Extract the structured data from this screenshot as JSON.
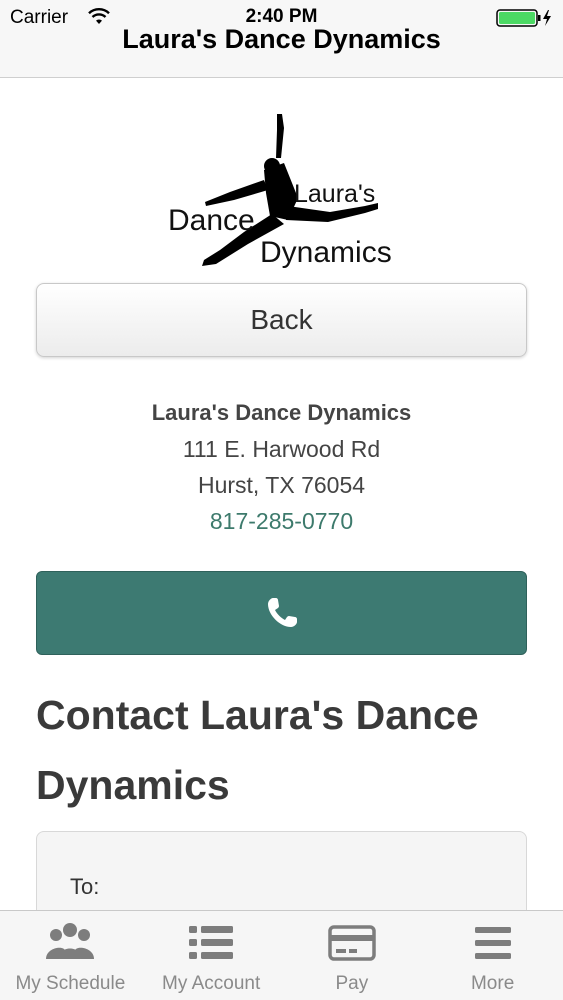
{
  "status_bar": {
    "carrier": "Carrier",
    "time": "2:40 PM",
    "battery_color": "#4cd964"
  },
  "nav": {
    "title": "Laura's Dance Dynamics"
  },
  "logo": {
    "line1": "Laura's",
    "line2": "Dance",
    "line3": "Dynamics"
  },
  "back_button": {
    "label": "Back"
  },
  "address": {
    "name": "Laura's Dance Dynamics",
    "street": "111 E. Harwood Rd",
    "city": "Hurst, TX 76054",
    "phone": "817-285-0770"
  },
  "call_button": {
    "icon": "phone-icon",
    "color": "#3d7a72"
  },
  "contact": {
    "heading": "Contact Laura's Dance Dynamics",
    "to_label": "To:"
  },
  "tabbar": {
    "items": [
      {
        "label": "My Schedule",
        "icon": "people-icon"
      },
      {
        "label": "My Account",
        "icon": "list-icon"
      },
      {
        "label": "Pay",
        "icon": "credit-card-icon"
      },
      {
        "label": "More",
        "icon": "menu-icon"
      }
    ]
  }
}
